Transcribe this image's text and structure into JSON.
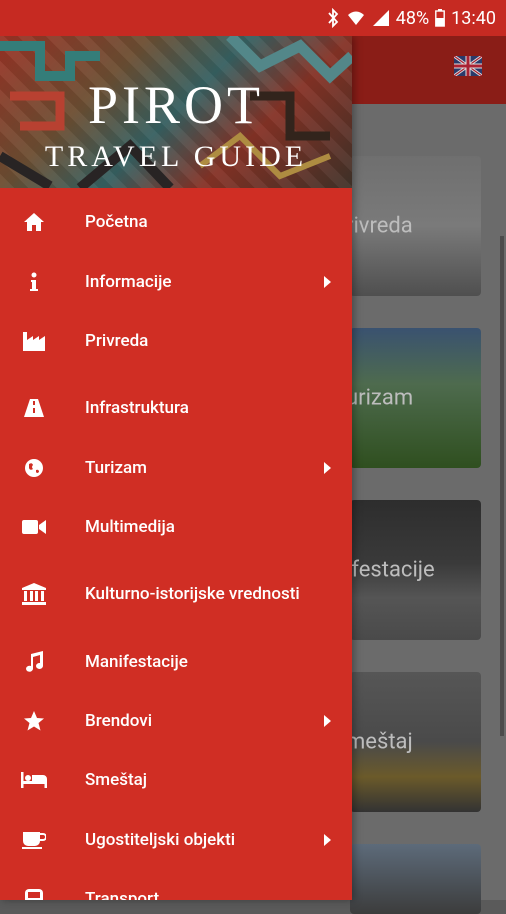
{
  "status_bar": {
    "battery": "48%",
    "time": "13:40",
    "background": "#c62a22"
  },
  "header": {
    "title": "PIROT",
    "subtitle": "TRAVEL GUIDE"
  },
  "menu": [
    {
      "label": "Početna",
      "icon": "home-icon",
      "has_submenu": false
    },
    {
      "label": "Informacije",
      "icon": "info-icon",
      "has_submenu": true
    },
    {
      "label": "Privreda",
      "icon": "factory-icon",
      "has_submenu": false
    },
    {
      "label": "Infrastruktura",
      "icon": "road-icon",
      "has_submenu": false
    },
    {
      "label": "Turizam",
      "icon": "globe-icon",
      "has_submenu": true
    },
    {
      "label": "Multimedija",
      "icon": "video-camera-icon",
      "has_submenu": false
    },
    {
      "label": "Kulturno-istorijske vrednosti",
      "icon": "museum-icon",
      "has_submenu": false
    },
    {
      "label": "Manifestacije",
      "icon": "music-note-icon",
      "has_submenu": false
    },
    {
      "label": "Brendovi",
      "icon": "star-icon",
      "has_submenu": true
    },
    {
      "label": "Smeštaj",
      "icon": "bed-icon",
      "has_submenu": false
    },
    {
      "label": "Ugostiteljski objekti",
      "icon": "coffee-cup-icon",
      "has_submenu": true
    },
    {
      "label": "Transport",
      "icon": "bus-icon",
      "has_submenu": false
    }
  ],
  "background_cards": [
    {
      "label": "rivreda"
    },
    {
      "label": "urizam"
    },
    {
      "label": "ifestacije"
    },
    {
      "label": "meštaj"
    },
    {
      "label": ""
    }
  ],
  "colors": {
    "drawer": "#d02e24",
    "app_bar": "#8a1d17",
    "text": "#ffffff"
  }
}
